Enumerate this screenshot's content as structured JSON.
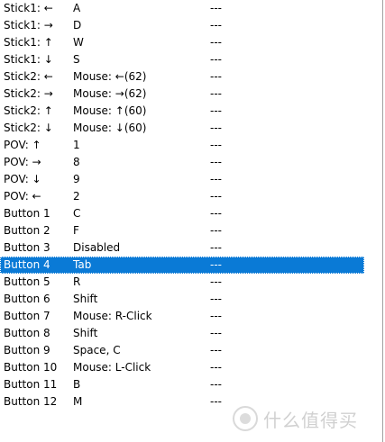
{
  "rows": [
    {
      "input": "Stick1: ←",
      "mapping": "A",
      "extra": "---"
    },
    {
      "input": "Stick1: →",
      "mapping": "D",
      "extra": "---"
    },
    {
      "input": "Stick1: ↑",
      "mapping": "W",
      "extra": "---"
    },
    {
      "input": "Stick1: ↓",
      "mapping": "S",
      "extra": "---"
    },
    {
      "input": "Stick2: ←",
      "mapping": "Mouse: ←(62)",
      "extra": "---"
    },
    {
      "input": "Stick2: →",
      "mapping": "Mouse: →(62)",
      "extra": "---"
    },
    {
      "input": "Stick2: ↑",
      "mapping": "Mouse: ↑(60)",
      "extra": "---"
    },
    {
      "input": "Stick2: ↓",
      "mapping": "Mouse: ↓(60)",
      "extra": "---"
    },
    {
      "input": "POV: ↑",
      "mapping": "1",
      "extra": "---"
    },
    {
      "input": "POV: →",
      "mapping": "8",
      "extra": "---"
    },
    {
      "input": "POV: ↓",
      "mapping": "9",
      "extra": "---"
    },
    {
      "input": "POV: ←",
      "mapping": "2",
      "extra": "---"
    },
    {
      "input": "Button 1",
      "mapping": "C",
      "extra": "---"
    },
    {
      "input": "Button 2",
      "mapping": "F",
      "extra": "---"
    },
    {
      "input": "Button 3",
      "mapping": "Disabled",
      "extra": "---"
    },
    {
      "input": "Button 4",
      "mapping": "Tab",
      "extra": "---"
    },
    {
      "input": "Button 5",
      "mapping": "R",
      "extra": "---"
    },
    {
      "input": "Button 6",
      "mapping": "Shift",
      "extra": "---"
    },
    {
      "input": "Button 7",
      "mapping": "Mouse: R-Click",
      "extra": "---"
    },
    {
      "input": "Button 8",
      "mapping": "Shift",
      "extra": "---"
    },
    {
      "input": "Button 9",
      "mapping": "Space, C",
      "extra": "---"
    },
    {
      "input": "Button 10",
      "mapping": "Mouse: L-Click",
      "extra": "---"
    },
    {
      "input": "Button 11",
      "mapping": "B",
      "extra": "---"
    },
    {
      "input": "Button 12",
      "mapping": "M",
      "extra": "---"
    }
  ],
  "selected_row": "Button 4",
  "colors": {
    "selection": "#0a7ad6"
  },
  "watermark": {
    "text": "什么值得买",
    "icon": "smzdm-logo-icon"
  }
}
